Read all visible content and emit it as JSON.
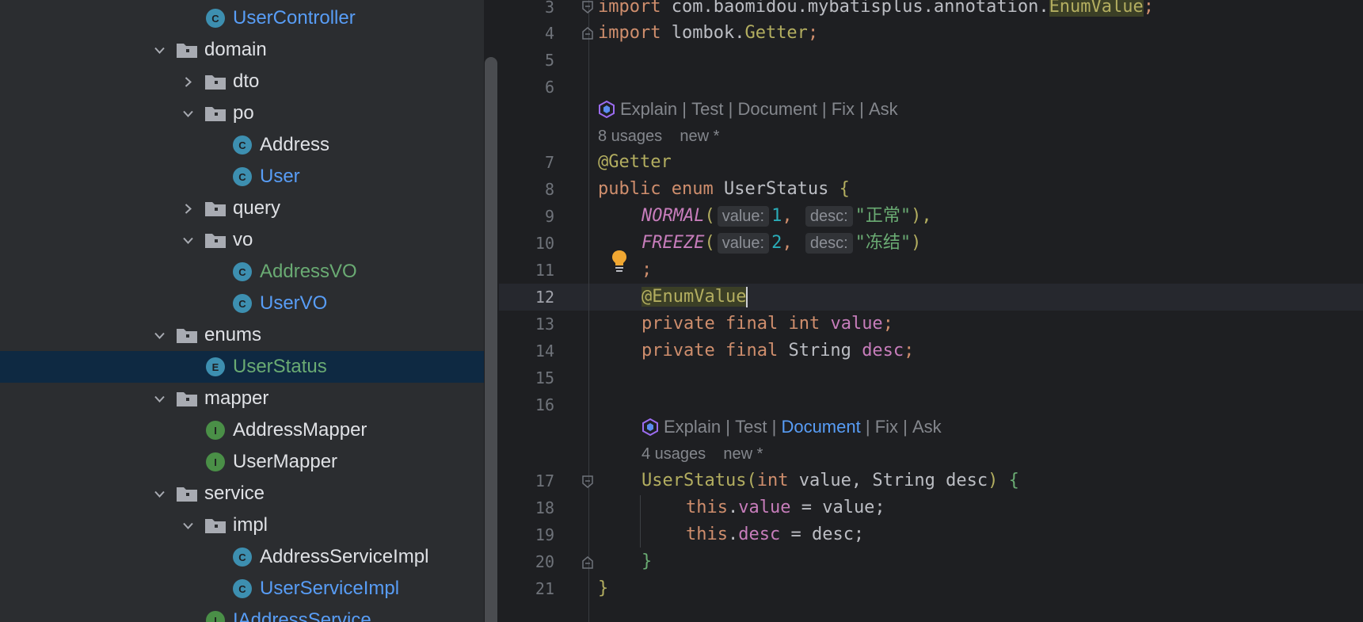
{
  "tree": {
    "items": [
      {
        "label": "UserController",
        "kind": "class",
        "color": "#589df6"
      },
      {
        "label": "domain",
        "kind": "folder"
      },
      {
        "label": "dto",
        "kind": "folder"
      },
      {
        "label": "po",
        "kind": "folder"
      },
      {
        "label": "Address",
        "kind": "class"
      },
      {
        "label": "User",
        "kind": "class",
        "color": "#589df6"
      },
      {
        "label": "query",
        "kind": "folder"
      },
      {
        "label": "vo",
        "kind": "folder"
      },
      {
        "label": "AddressVO",
        "kind": "class",
        "color": "#6aab73"
      },
      {
        "label": "UserVO",
        "kind": "class",
        "color": "#589df6"
      },
      {
        "label": "enums",
        "kind": "folder"
      },
      {
        "label": "UserStatus",
        "kind": "enum",
        "color": "#6aab73",
        "selected": true
      },
      {
        "label": "mapper",
        "kind": "folder"
      },
      {
        "label": "AddressMapper",
        "kind": "interface"
      },
      {
        "label": "UserMapper",
        "kind": "interface"
      },
      {
        "label": "service",
        "kind": "folder"
      },
      {
        "label": "impl",
        "kind": "folder"
      },
      {
        "label": "AddressServiceImpl",
        "kind": "class"
      },
      {
        "label": "UserServiceImpl",
        "kind": "class",
        "color": "#589df6"
      },
      {
        "label": "IAddressService",
        "kind": "interface",
        "color": "#589df6"
      }
    ],
    "class_badge": "C",
    "enum_badge": "E",
    "interface_badge": "I"
  },
  "editor": {
    "line_numbers": [
      "3",
      "4",
      "5",
      "6",
      "7",
      "8",
      "9",
      "10",
      "11",
      "12",
      "13",
      "14",
      "15",
      "16",
      "17",
      "18",
      "19",
      "20",
      "21"
    ],
    "current_line": "12",
    "import1": {
      "kw": "import",
      "pkg": "com.baomidou.mybatisplus.annotation.",
      "cls": "EnumValue",
      "semi": ";"
    },
    "import2": {
      "kw": "import",
      "pkg": "lombok.",
      "cls": "Getter",
      "semi": ";"
    },
    "lens1": {
      "explain": "Explain",
      "sep": "|",
      "test": "Test",
      "document": "Document",
      "fix": "Fix",
      "ask": "Ask"
    },
    "usage1": {
      "count": "8 usages",
      "status": "new *"
    },
    "getter": "@Getter",
    "enum_decl": {
      "pub": "public",
      "enum": "enum",
      "name": "UserStatus",
      "brace": "{"
    },
    "normal": {
      "name": "NORMAL",
      "hint1": "value:",
      "v1": "1",
      "hint2": "desc:",
      "v2": "\"正常\"",
      "tail": "),"
    },
    "freeze": {
      "name": "FREEZE",
      "hint1": "value:",
      "v1": "2",
      "hint2": "desc:",
      "v2": "\"冻结\"",
      "tail": ")"
    },
    "semicolon": ";",
    "enum_value_ann": "@EnumValue",
    "field1": {
      "priv": "private",
      "fin": "final",
      "type": "int",
      "name": "value",
      "semi": ";"
    },
    "field2": {
      "priv": "private",
      "fin": "final",
      "type": "String",
      "name": "desc",
      "semi": ";"
    },
    "lens2": {
      "explain": "Explain",
      "sep": "|",
      "test": "Test",
      "document": "Document",
      "fix": "Fix",
      "ask": "Ask"
    },
    "usage2": {
      "count": "4 usages",
      "status": "new *"
    },
    "ctor": {
      "name": "UserStatus",
      "open": "(",
      "t1": "int",
      "p1": " value, ",
      "t2": "String",
      "p2": " desc",
      "close": ") ",
      "brace": "{"
    },
    "assign1": {
      "this": "this",
      "dot": ".",
      "field": "value",
      "rest": " = value;"
    },
    "assign2": {
      "this": "this",
      "dot": ".",
      "field": "desc",
      "rest": " = desc;"
    },
    "close_inner": "}",
    "close_outer": "}"
  }
}
